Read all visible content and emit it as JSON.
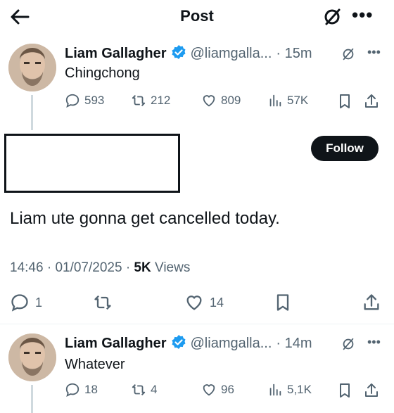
{
  "header": {
    "title": "Post"
  },
  "colors": {
    "verified": "#1d9bf0",
    "text": "#0f1419",
    "muted": "#536471",
    "follow_bg": "#0f1419"
  },
  "reply1": {
    "name": "Liam Gallagher",
    "handle": "@liamgalla...",
    "time": "· 15m",
    "text": "Chingchong",
    "metrics": {
      "replies": "593",
      "reposts": "212",
      "likes": "809",
      "views": "57K"
    }
  },
  "main_post": {
    "follow_label": "Follow",
    "text": "Liam ute gonna get cancelled today.",
    "time": "14:46",
    "date": "01/07/2025",
    "views_count": "5K",
    "views_label": "Views",
    "actions": {
      "replies": "1",
      "likes": "14"
    }
  },
  "reply2": {
    "name": "Liam Gallagher",
    "handle": "@liamgalla...",
    "time": "· 14m",
    "text": "Whatever",
    "metrics": {
      "replies": "18",
      "reposts": "4",
      "likes": "96",
      "views": "5,1K"
    }
  }
}
